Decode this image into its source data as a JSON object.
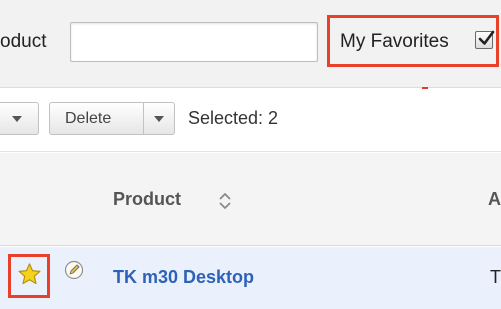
{
  "filter": {
    "label": "oduct",
    "input_value": "",
    "favorites_label": "My Favorites",
    "favorites_checked": true
  },
  "toolbar": {
    "delete_label": "Delete",
    "selected_label": "Selected: 2"
  },
  "table": {
    "columns": [
      {
        "label": "Product",
        "sortable": true
      },
      {
        "label": "A"
      }
    ],
    "rows": [
      {
        "favorite": true,
        "product": "TK m30 Desktop",
        "next": "T"
      }
    ]
  },
  "colors": {
    "highlight_border": "#e8402a",
    "link": "#2e62b8",
    "row_background": "#eaf1fc",
    "favorite_star": "#f5d31c"
  },
  "icons": {
    "favorites_checkbox": "checkbox-checked-icon",
    "split_caret": "caret-down-icon",
    "sort": "sort-up-down-icon",
    "favorite": "star-icon",
    "edit": "pencil-edit-icon"
  }
}
